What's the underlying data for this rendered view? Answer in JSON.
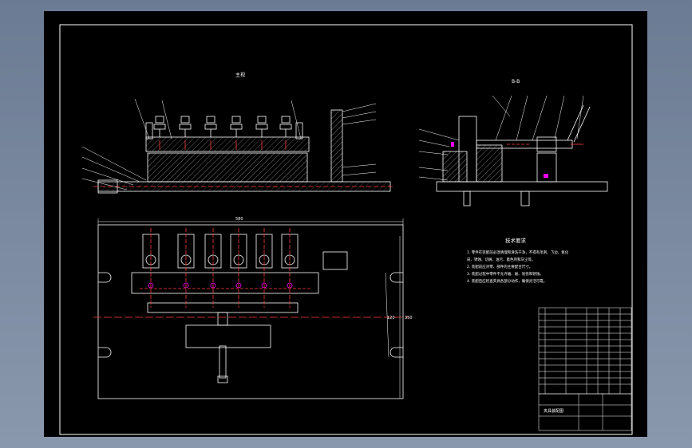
{
  "colors": {
    "window_bg": "#74849c",
    "sheet_bg": "#000000",
    "line": "#ffffff",
    "hidden": "#ff3b3b",
    "accent": "#ff00ff"
  },
  "front_view": {
    "title": "主视"
  },
  "side_view": {
    "title": "B-B"
  },
  "plan_view": {
    "dim_width": "580",
    "dim_h1": "120",
    "dim_h2": "350"
  },
  "tech_requirements": {
    "title": "技术要求",
    "lines": [
      "1. 零件在装配前必须清理和清洗干净，不得有毛刺、飞边、氧化",
      "皮、锈蚀、切屑、油污、着色剂和灰尘等。",
      "2. 装配前应对零、部件的主要配合尺寸。",
      "3. 装配过程中零件不允许磕、碰、划伤和锈蚀。",
      "4. 装配后应检查夹具各部分动作，确保灵活可靠。"
    ]
  },
  "title_block": {
    "name": "夹具装配图"
  }
}
